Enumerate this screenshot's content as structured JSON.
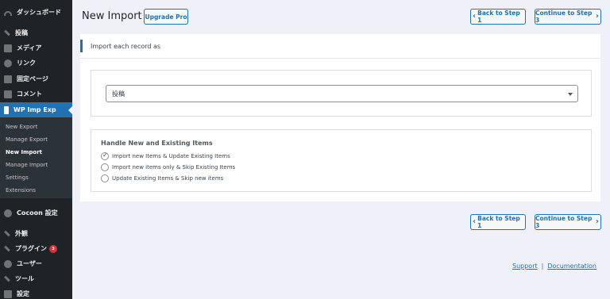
{
  "sidebar": {
    "items": [
      {
        "label": "ダッシュボード",
        "icon": "dashboard-icon"
      },
      {
        "label": "投稿",
        "icon": "pin-icon"
      },
      {
        "label": "メディア",
        "icon": "media-icon"
      },
      {
        "label": "リンク",
        "icon": "link-icon"
      },
      {
        "label": "固定ページ",
        "icon": "page-icon"
      },
      {
        "label": "コメント",
        "icon": "comment-icon"
      },
      {
        "label": "WP Imp Exp",
        "icon": "plugin-logo-icon"
      },
      {
        "label": "Cocoon 設定",
        "icon": "cocoon-icon"
      },
      {
        "label": "外観",
        "icon": "appearance-icon"
      },
      {
        "label": "プラグイン",
        "icon": "plugins-icon",
        "badge": "3"
      },
      {
        "label": "ユーザー",
        "icon": "users-icon"
      },
      {
        "label": "ツール",
        "icon": "tools-icon"
      },
      {
        "label": "設定",
        "icon": "settings-icon"
      }
    ],
    "submenu": [
      {
        "label": "New Export"
      },
      {
        "label": "Manage Export"
      },
      {
        "label": "New Import"
      },
      {
        "label": "Manage Import"
      },
      {
        "label": "Settings"
      },
      {
        "label": "Extensions"
      }
    ]
  },
  "header": {
    "title": "New Import",
    "upgrade_label": "Upgrade Pro",
    "back_label": "Back to Step 1",
    "continue_label": "Continue to Step 3"
  },
  "card": {
    "title": "Import each record as",
    "select_value": "投稿",
    "handle_title": "Handle New and Existing Items",
    "options": [
      {
        "label": "Import new Items & Update Existing Items",
        "checked": true
      },
      {
        "label": "Import new items only & Skip Existing Items",
        "checked": false
      },
      {
        "label": "Update Existing Items & Skip new items",
        "checked": false
      }
    ]
  },
  "bottom": {
    "back_label": "Back to Step 1",
    "continue_label": "Continue to Step 3"
  },
  "footer": {
    "support": "Support",
    "separator": "|",
    "documentation": "Documentation"
  },
  "colors": {
    "accent": "#2271b1",
    "sidebar_bg": "#1d2327",
    "submenu_bg": "#2c3338",
    "page_bg": "#f0f0f9",
    "badge": "#d63638"
  }
}
